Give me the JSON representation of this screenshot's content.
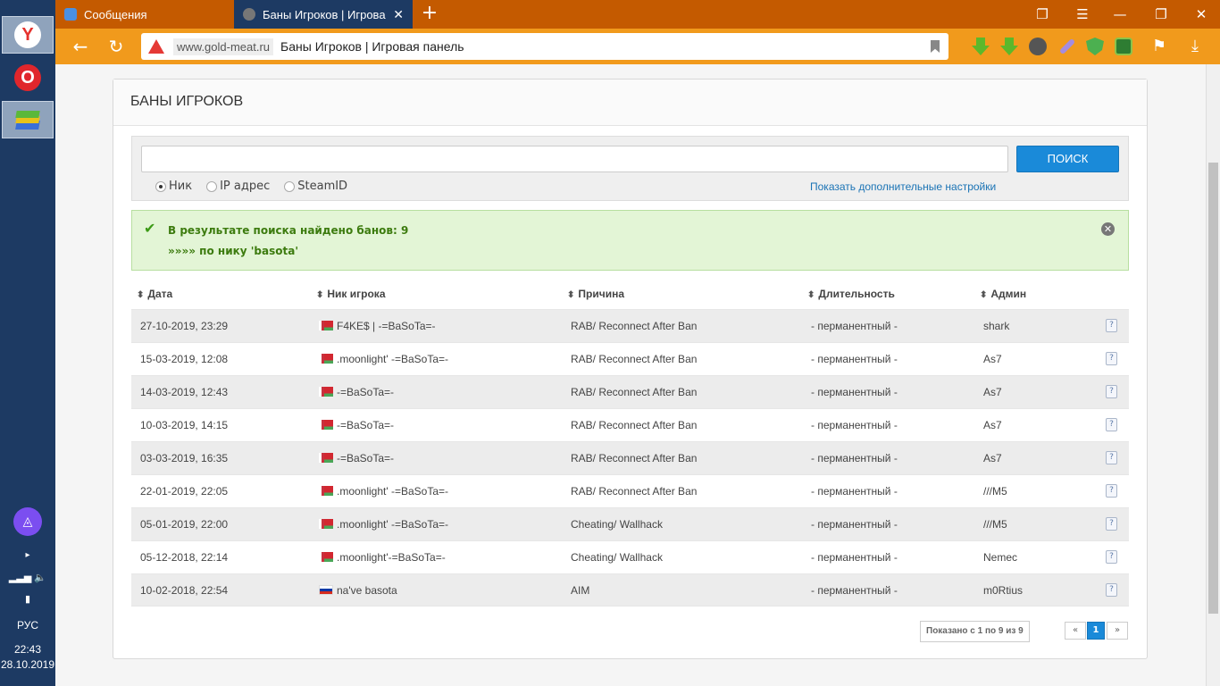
{
  "os": {
    "apps": [
      {
        "name": "yandex-browser",
        "glyph": "Y"
      },
      {
        "name": "opera",
        "glyph": "O"
      },
      {
        "name": "bluestacks",
        "glyph": ""
      }
    ],
    "language": "РУС",
    "time": "22:43",
    "date": "28.10.2019"
  },
  "browser": {
    "tabs": [
      {
        "title": "Сообщения",
        "active": false
      },
      {
        "title": "Баны Игроков | Игрова",
        "active": true
      }
    ],
    "address_host": "www.gold-meat.ru",
    "address_title": "Баны Игроков | Игровая панель"
  },
  "page": {
    "title": "БАНЫ ИГРОКОВ",
    "search": {
      "value": "",
      "button": "ПОИСК",
      "options": [
        "Ник",
        "IP адрес",
        "SteamID"
      ],
      "selected": "Ник",
      "more_link": "Показать дополнительные настройки"
    },
    "alert": {
      "line1": "В результате поиска найдено банов: 9",
      "line2": "»»»» по нику 'basota'"
    },
    "table": {
      "headers": [
        "Дата",
        "Ник игрока",
        "Причина",
        "Длительность",
        "Админ"
      ],
      "rows": [
        {
          "date": "27-10-2019, 23:29",
          "flag": "by",
          "nick": "F4KE$ | -=BaSoTa=-",
          "reason": "RAB/ Reconnect After Ban",
          "duration": "- перманентный -",
          "admin": "shark"
        },
        {
          "date": "15-03-2019, 12:08",
          "flag": "by",
          "nick": ".moonlight' -=BaSoTa=-",
          "reason": "RAB/ Reconnect After Ban",
          "duration": "- перманентный -",
          "admin": "As7"
        },
        {
          "date": "14-03-2019, 12:43",
          "flag": "by",
          "nick": "-=BaSoTa=-",
          "reason": "RAB/ Reconnect After Ban",
          "duration": "- перманентный -",
          "admin": "As7"
        },
        {
          "date": "10-03-2019, 14:15",
          "flag": "by",
          "nick": "-=BaSoTa=-",
          "reason": "RAB/ Reconnect After Ban",
          "duration": "- перманентный -",
          "admin": "As7"
        },
        {
          "date": "03-03-2019, 16:35",
          "flag": "by",
          "nick": "-=BaSoTa=-",
          "reason": "RAB/ Reconnect After Ban",
          "duration": "- перманентный -",
          "admin": "As7"
        },
        {
          "date": "22-01-2019, 22:05",
          "flag": "by",
          "nick": ".moonlight' -=BaSoTa=-",
          "reason": "RAB/ Reconnect After Ban",
          "duration": "- перманентный -",
          "admin": "///M5"
        },
        {
          "date": "05-01-2019, 22:00",
          "flag": "by",
          "nick": ".moonlight' -=BaSoTa=-",
          "reason": "Cheating/ Wallhack",
          "duration": "- перманентный -",
          "admin": "///M5"
        },
        {
          "date": "05-12-2018, 22:14",
          "flag": "by",
          "nick": ".moonlight'-=BaSoTa=-",
          "reason": "Cheating/ Wallhack",
          "duration": "- перманентный -",
          "admin": "Nemec"
        },
        {
          "date": "10-02-2018, 22:54",
          "flag": "ru",
          "nick": "na've basota",
          "reason": "AIM",
          "duration": "- перманентный -",
          "admin": "m0Rtius"
        }
      ]
    },
    "pager": {
      "info": "Показано с 1 по 9 из 9",
      "prev": "«",
      "current": "1",
      "next": "»"
    }
  },
  "colors": {
    "tabbar": "#c45a00",
    "navbar": "#f19a1c",
    "os_panel": "#1d3a63",
    "accent": "#1a8ad9",
    "alert_bg": "#e3f5d6"
  }
}
